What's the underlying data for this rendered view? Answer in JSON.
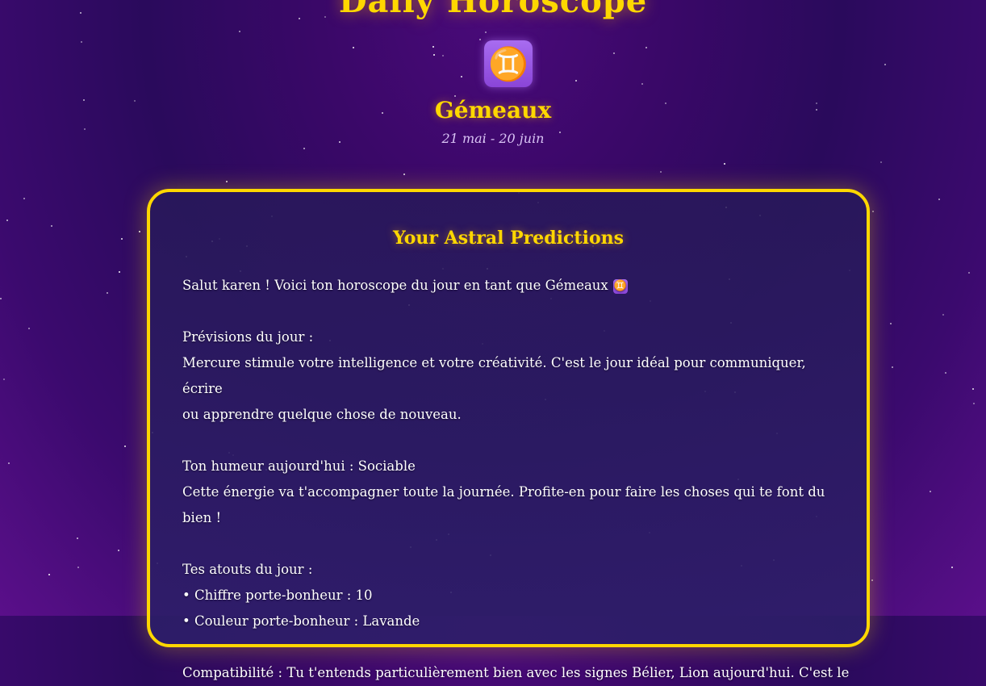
{
  "header": {
    "title": "Daily Horoscope",
    "sign_symbol": "♊",
    "sign_icon_name": "gemini-icon",
    "sign_name": "Gémeaux",
    "sign_dates": "21 mai - 20 juin"
  },
  "card": {
    "title": "Your Astral Predictions",
    "greeting": "Salut karen ! Voici ton horoscope du jour en tant que Gémeaux",
    "greeting_symbol": "♊",
    "forecast_heading": "Prévisions du jour :",
    "forecast_line1": "Mercure stimule votre intelligence et votre créativité. C'est le jour idéal pour communiquer, écrire",
    "forecast_line2": "ou apprendre quelque chose de nouveau.",
    "mood_heading": "Ton humeur aujourd'hui : Sociable",
    "mood_text": "Cette énergie va t'accompagner toute la journée. Profite-en pour faire les choses qui te font du bien !",
    "assets_heading": "Tes atouts du jour :",
    "lucky_number": "• Chiffre porte-bonheur : 10",
    "lucky_color": "• Couleur porte-bonheur : Lavande",
    "compat_partial": "Compatibilité : Tu t'entends particulièrement bien avec les signes Bélier, Lion aujourd'hui. C'est le"
  },
  "colors": {
    "accent_gold": "#ffd700",
    "badge_purple": "#9a58e4",
    "background_purple": "#3a0868"
  }
}
